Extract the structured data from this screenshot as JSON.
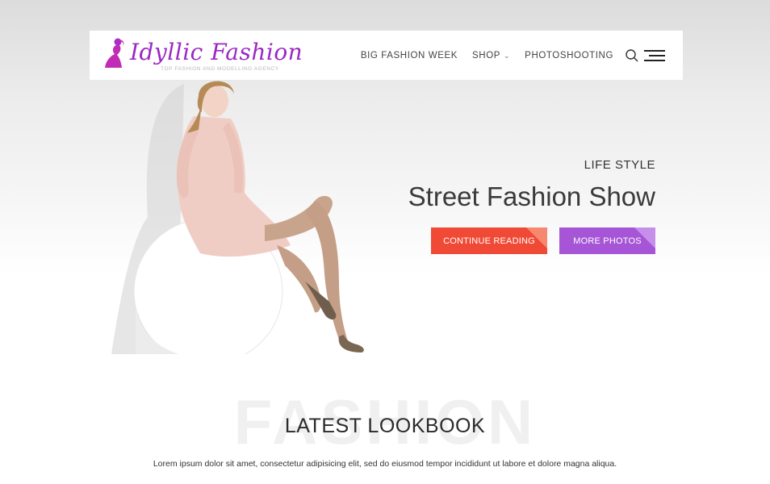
{
  "brand": {
    "name": "Idyllic Fashion",
    "tagline": "TOP FASHION AND MODELLING AGENCY",
    "logo_icon": "woman-silhouette-icon",
    "logo_color": "#9b27c4"
  },
  "nav": {
    "items": [
      {
        "label": "BIG FASHION WEEK"
      },
      {
        "label": "SHOP",
        "has_dropdown": true
      },
      {
        "label": "PHOTOSHOOTING"
      }
    ],
    "search_icon": "search-icon",
    "menu_icon": "hamburger-menu-icon"
  },
  "hero": {
    "eyebrow": "LIFE STYLE",
    "title": "Street Fashion Show",
    "buttons": {
      "continue_reading": "CONTINUE READING",
      "more_photos": "MORE PHOTOS"
    },
    "colors": {
      "continue": "#f04a36",
      "more": "#a555d6"
    }
  },
  "lookbook": {
    "bg_word": "FASHION",
    "title": "LATEST LOOKBOOK",
    "description": "Lorem ipsum dolor sit amet, consectetur adipisicing elit, sed do eiusmod tempor incididunt ut labore et dolore magna aliqua."
  }
}
